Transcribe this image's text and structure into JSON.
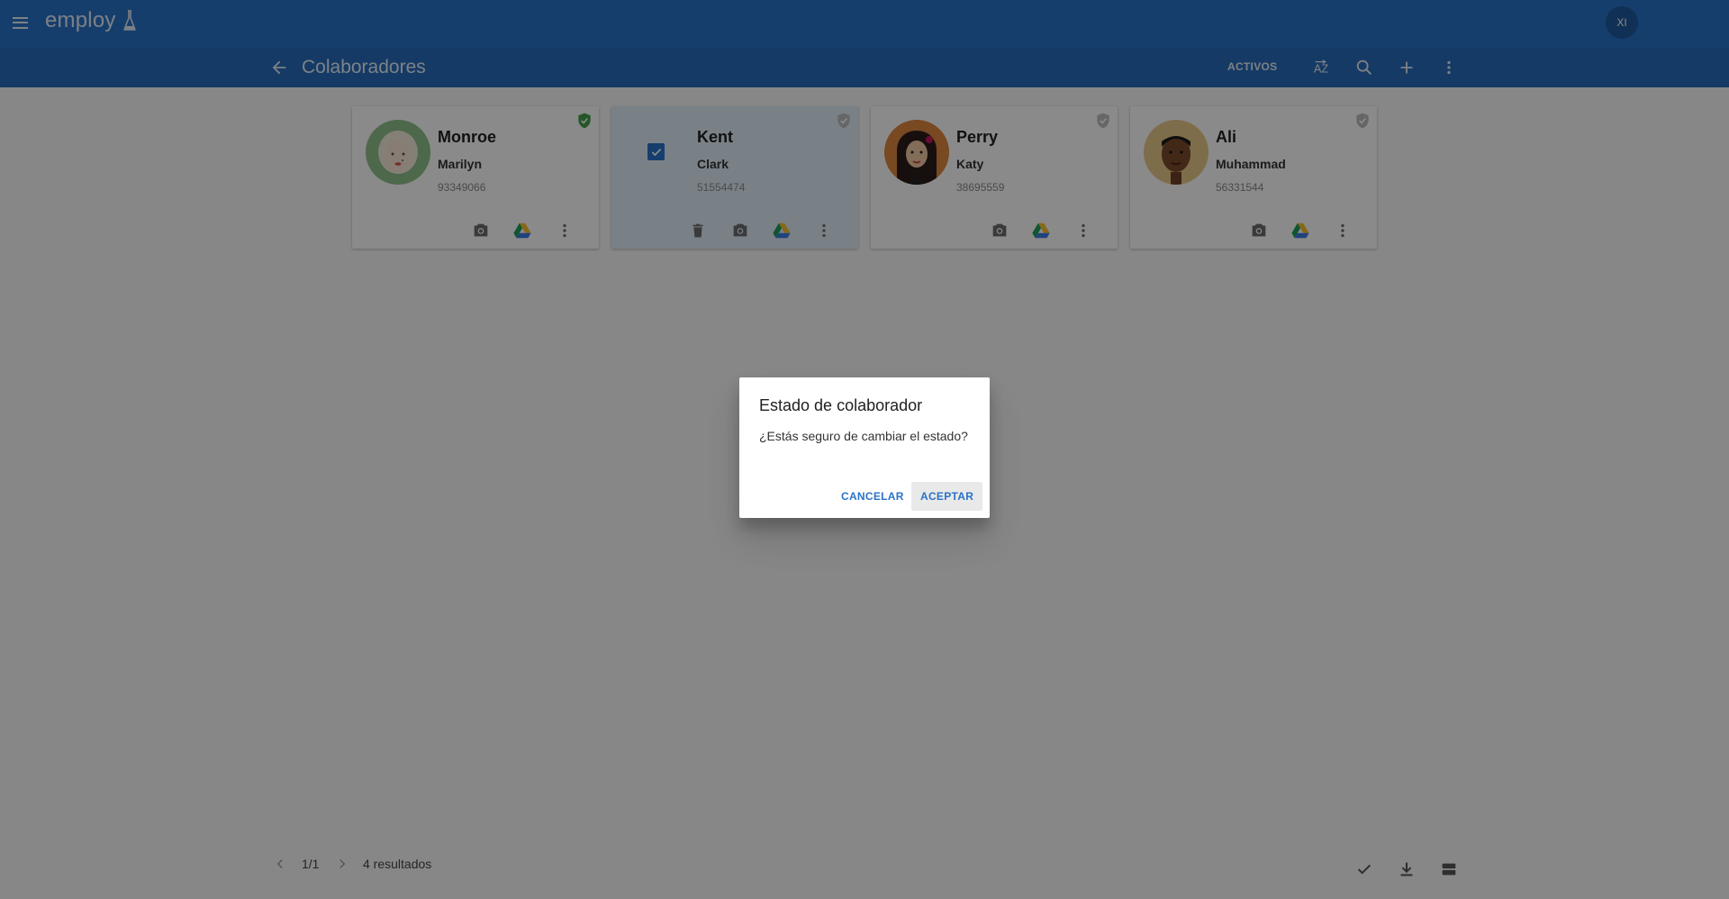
{
  "app": {
    "brand": "employ",
    "user_initials": "XI"
  },
  "toolbar": {
    "title": "Colaboradores",
    "filter_label": "ACTIVOS",
    "icons": [
      "back-arrow-icon",
      "sort-az-icon",
      "search-icon",
      "add-icon",
      "more-vert-icon"
    ]
  },
  "colors": {
    "primary": "#2a73c8",
    "status_active": "#43a047",
    "status_inactive": "#bdbdbd",
    "selected_card": "#dfeef9"
  },
  "cards": [
    {
      "lastname": "Monroe",
      "firstname": "Marilyn",
      "docnum": "93349066",
      "status": "active",
      "selected": false,
      "actions": [
        "camera-icon",
        "drive-icon",
        "more-vert-icon"
      ]
    },
    {
      "lastname": "Kent",
      "firstname": "Clark",
      "docnum": "51554474",
      "status": "inactive",
      "selected": true,
      "actions": [
        "delete-icon",
        "camera-icon",
        "drive-icon",
        "more-vert-icon"
      ]
    },
    {
      "lastname": "Perry",
      "firstname": "Katy",
      "docnum": "38695559",
      "status": "inactive",
      "selected": false,
      "actions": [
        "camera-icon",
        "drive-icon",
        "more-vert-icon"
      ]
    },
    {
      "lastname": "Ali",
      "firstname": "Muhammad",
      "docnum": "56331544",
      "status": "inactive",
      "selected": false,
      "actions": [
        "camera-icon",
        "drive-icon",
        "more-vert-icon"
      ]
    }
  ],
  "pagination": {
    "page": "1/1",
    "results": "4 resultados"
  },
  "footer_icons": [
    "check-icon",
    "download-icon",
    "view-stream-icon"
  ],
  "dialog": {
    "title": "Estado de colaborador",
    "message": "¿Estás seguro de cambiar el estado?",
    "cancel_label": "CANCELAR",
    "accept_label": "ACEPTAR"
  }
}
